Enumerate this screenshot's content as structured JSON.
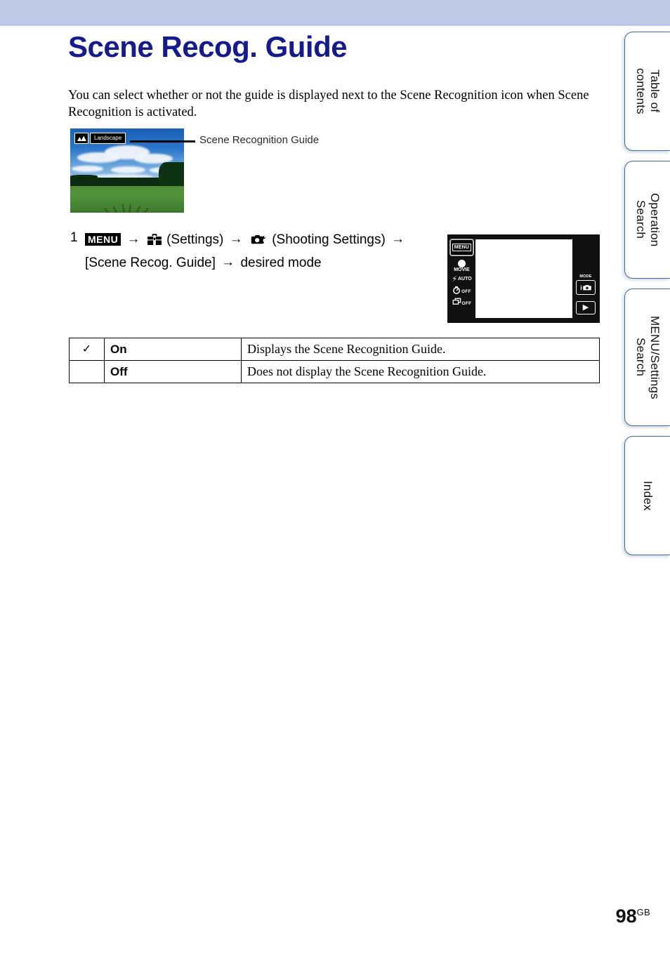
{
  "document": {
    "title": "Scene Recog. Guide",
    "intro": "You can select whether or not the guide is displayed next to the Scene Recognition icon when Scene Recognition is activated.",
    "page_number": "98",
    "page_suffix": "GB"
  },
  "figure": {
    "scene_icon_name": "mountain-icon",
    "scene_badge_label": "Landscape",
    "callout_label": "Scene Recognition Guide"
  },
  "step": {
    "number": "1",
    "menu_chip": "MENU",
    "arrow": "→",
    "settings_label": "(Settings)",
    "shooting_label": "(Shooting Settings)",
    "item_label": "[Scene Recog. Guide]",
    "tail_label": "desired mode",
    "settings_icon_name": "toolbox-icon",
    "shooting_icon_name": "camera-wrench-icon"
  },
  "lcd": {
    "menu_button": "MENU",
    "movie_label": "MOVIE",
    "flash_label": "AUTO",
    "flash_glyph": "⚡",
    "selftimer_label": "OFF",
    "burst_label": "OFF",
    "mode_label": "MODE",
    "mode_glyph": "i",
    "play_glyph": "▶"
  },
  "options": {
    "rows": [
      {
        "checked": true,
        "check_glyph": "✓",
        "name": "On",
        "description": "Displays the Scene Recognition Guide."
      },
      {
        "checked": false,
        "check_glyph": "",
        "name": "Off",
        "description": "Does not display the Scene Recognition Guide."
      }
    ]
  },
  "sidebar": {
    "tabs": [
      {
        "label": "Table of\ncontents"
      },
      {
        "label": "Operation\nSearch"
      },
      {
        "label": "MENU/Settings\nSearch"
      },
      {
        "label": "Index"
      }
    ]
  },
  "colors": {
    "header_band": "#bec9e8",
    "title": "#151b8d",
    "tab_border": "#3b6ea8"
  }
}
